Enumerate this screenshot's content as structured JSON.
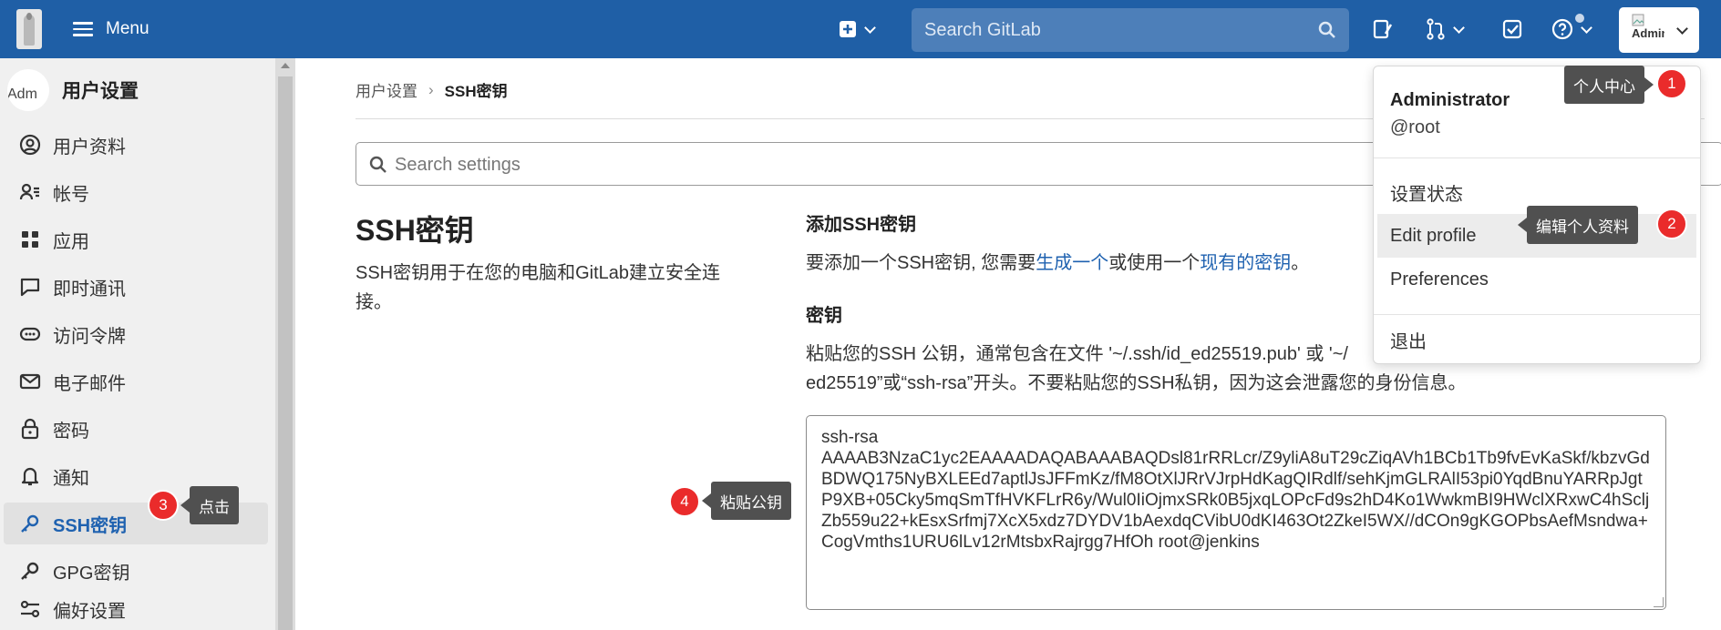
{
  "topbar": {
    "menu_label": "Menu",
    "search_placeholder": "Search GitLab",
    "avatar_alt": "Administ",
    "colors": {
      "bg": "#1f5fa6",
      "search_bg": "#4d7fb9"
    }
  },
  "sidebar": {
    "avatar_alt": "Adm",
    "title": "用户设置",
    "items": [
      {
        "label": "用户资料",
        "icon": "profile-icon"
      },
      {
        "label": "帐号",
        "icon": "account-icon"
      },
      {
        "label": "应用",
        "icon": "applications-icon"
      },
      {
        "label": "即时通讯",
        "icon": "chat-icon"
      },
      {
        "label": "访问令牌",
        "icon": "token-icon"
      },
      {
        "label": "电子邮件",
        "icon": "email-icon"
      },
      {
        "label": "密码",
        "icon": "lock-icon"
      },
      {
        "label": "通知",
        "icon": "bell-icon"
      },
      {
        "label": "SSH密钥",
        "icon": "key-icon",
        "active": true
      },
      {
        "label": "GPG密钥",
        "icon": "key-icon"
      },
      {
        "label": "偏好设置",
        "icon": "preferences-icon"
      }
    ]
  },
  "breadcrumb": {
    "parent": "用户设置",
    "separator": "›",
    "current": "SSH密钥"
  },
  "search_settings": {
    "placeholder": "Search settings"
  },
  "section": {
    "title": "SSH密钥",
    "description": "SSH密钥用于在您的电脑和GitLab建立安全连接。"
  },
  "add_key": {
    "title": "添加SSH密钥",
    "text_before": "要添加一个SSH密钥, 您需要",
    "link_generate": "生成一个",
    "text_middle": "或使用一个",
    "link_existing": "现有的密钥",
    "text_after": "。"
  },
  "key_field": {
    "title": "密钥",
    "help_line1": "粘贴您的SSH 公钥，通常包含在文件 '~/.ssh/id_ed25519.pub' 或 '~/",
    "help_line2": "ed25519”或“ssh-rsa”开头。不要粘贴您的SSH私钥，因为这会泄露您的身份信息。",
    "value": "ssh-rsa\nAAAAB3NzaC1yc2EAAAADAQABAAABAQDsl81rRRLcr/Z9yliA8uT29cZiqAVh1BCb1Tb9fvEvKaSkf/kbzvGdBDWQ175NyBXLEEd7aptlJsJFFmKz/fM8OtXlJRrVJrpHdKagQIRdlf/sehKjmGLRAlI53pi0YqdBnuYARRpJgtP9XB+05Cky5mqSmTfHVKFLrR6y/Wul0IiOjmxSRk0B5jxqLOPcFd9s2hD4Ko1WwkmBI9HWclXRxwC4hScljZb559u22+kEsxSrfmj7XcX5xdz7DYDV1bAexdqCVibU0dKI463Ot2ZkeI5WX//dCOn9gKGOPbsAefMsndwa+CogVmths1URU6lLv12rMtsbxRajrgg7HfOh root@jenkins"
  },
  "user_dropdown": {
    "name": "Administrator",
    "username": "@root",
    "items": [
      "设置状态",
      "Edit profile",
      "Preferences",
      "退出"
    ]
  },
  "annotations": [
    {
      "number": "1",
      "text": "个人中心"
    },
    {
      "number": "2",
      "text": "编辑个人资料"
    },
    {
      "number": "3",
      "text": "点击"
    },
    {
      "number": "4",
      "text": "粘贴公钥"
    }
  ]
}
